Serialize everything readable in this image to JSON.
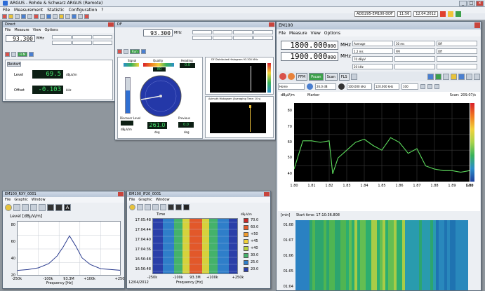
{
  "app": {
    "title": "ARGUS - Rohde & Schwarz ARGUS (Remote)",
    "menu": [
      "File",
      "Measurement",
      "Statistic",
      "Configuration",
      "?"
    ],
    "status_label": "ADD295-EM100-DDF",
    "status_date": "12.04.2012",
    "status_time": "11:56"
  },
  "win_a": {
    "title": "Direct",
    "menu": [
      "File",
      "Measure",
      "View",
      "Options"
    ],
    "freq": "93.300",
    "freq_unit": "MHz",
    "level_label": "Level",
    "level_value": "69.5",
    "level_unit": "dBµV/m",
    "offset_label": "Offset",
    "offset_value": "-0.103",
    "offset_unit": "kHz"
  },
  "win_b": {
    "title": "DF",
    "freq": "93.300",
    "freq_unit": "MHz",
    "signal_label": "Signal",
    "quality_label": "Quality",
    "quality_value": "80",
    "heading_label": "Heading",
    "heading_value": "0.0",
    "bearing_value": "261.0",
    "bearing_unit": "deg",
    "previous_label": "Previous",
    "previous_value": "0.0",
    "previous_unit": "deg",
    "discover_label": "Discover Level",
    "discover_unit": "dBµV/m",
    "hist1_title": "DF Distributed Histogram 93.300 MHz",
    "hist2_title": "Azimuth Histogram (Averaging Time: 10 s)"
  },
  "em100": {
    "title": "EM100",
    "menu": [
      "File",
      "Measure",
      "View",
      "Options"
    ],
    "freq1": "1800.000",
    "freq1_small": "000",
    "freq2": "1900.000",
    "freq2_small": "000",
    "freq_unit": "MHz",
    "params": [
      "Average",
      "30 ms",
      "Off",
      "1.2 ms",
      "FM",
      "Off",
      "70 dBµV",
      "",
      "",
      "20 kHz",
      "",
      ""
    ],
    "modes": [
      "FFM",
      "Pscan",
      "Scan",
      "FLS"
    ],
    "mode_active": "Pscan",
    "ctl": [
      "Home",
      "26.0 dB",
      "100.000 kHz",
      "120.000 kHz",
      "100"
    ],
    "spec_ylabel": "dBµV/m",
    "spec_marker": "Marker",
    "spec_scan": "Scan: 209.07/s",
    "spec_yticks": [
      "80",
      "70",
      "60",
      "50",
      "40"
    ],
    "spec_xticks": [
      "1.80",
      "1.81",
      "1.82",
      "1.83",
      "1.84",
      "1.85",
      "1.86",
      "1.87",
      "1.88",
      "1.89",
      "1.90"
    ],
    "spec_xunit": "GHz",
    "wf_ylabel": "[min]",
    "wf_start": "Start time: 17:10:36.808",
    "wf_yticks": [
      "01:08",
      "01:07",
      "01:06",
      "01:05",
      "01:04"
    ]
  },
  "win_level": {
    "title": "EM100_RXY_0001",
    "menu": [
      "File",
      "Graphic",
      "Window"
    ],
    "ylabel": "Level [dBµV/m]",
    "yticks": [
      "80",
      "60",
      "40",
      "20"
    ],
    "xticks": [
      "-250k",
      "-100k",
      "93.3M",
      "+100k",
      "+250k"
    ],
    "xlabel": "Frequency [Hz]"
  },
  "win_if": {
    "title": "EM100_IF20_0001",
    "menu": [
      "File",
      "Graphic",
      "Window"
    ],
    "time_label": "Time",
    "yticks": [
      "17:05:48",
      "17:04:44",
      "17:04:40",
      "17:04:36",
      "16:56:48",
      "16:56:48"
    ],
    "xticks": [
      "-250k",
      "-100k",
      "93.3M",
      "+100k",
      "+250k"
    ],
    "xlabel": "Frequency [Hz]",
    "date": "12/04/2012",
    "legend_unit": "dBµV/m",
    "legend": [
      "70.0",
      "60.0",
      "+50",
      "+45",
      "+40",
      "30.0",
      "25.0",
      "20.0"
    ]
  },
  "chart_data": [
    {
      "type": "line",
      "title": "",
      "xlabel": "GHz",
      "ylabel": "dBµV/m",
      "x_range": [
        1.8,
        1.9
      ],
      "ylim": [
        35,
        85
      ],
      "series": [
        {
          "x": [
            1.8,
            1.805,
            1.81,
            1.815,
            1.82,
            1.822,
            1.825,
            1.83,
            1.835,
            1.84,
            1.845,
            1.85,
            1.855,
            1.86,
            1.865,
            1.87,
            1.875,
            1.88,
            1.885,
            1.89,
            1.895,
            1.9
          ],
          "y": [
            43,
            61,
            61,
            60,
            61,
            40,
            50,
            55,
            60,
            62,
            58,
            55,
            63,
            60,
            53,
            56,
            45,
            43,
            42,
            42,
            41,
            42
          ]
        }
      ]
    },
    {
      "type": "line",
      "title": "",
      "xlabel": "Frequency [Hz]",
      "ylabel": "Level [dBµV/m]",
      "ylim": [
        20,
        85
      ],
      "series": [
        {
          "x": [
            -250,
            -200,
            -150,
            -100,
            -60,
            -30,
            0,
            30,
            60,
            100,
            150,
            200,
            250
          ],
          "y": [
            27,
            28,
            30,
            35,
            44,
            55,
            68,
            56,
            42,
            34,
            29,
            28,
            27
          ]
        }
      ]
    }
  ]
}
